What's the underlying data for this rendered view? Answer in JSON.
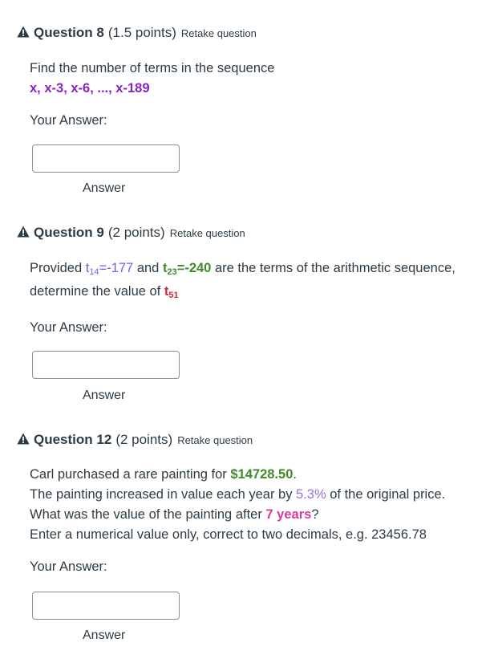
{
  "questions": [
    {
      "title": "Question 8",
      "points": "(1.5 points)",
      "retake": "Retake question",
      "prompt": "Find the number of terms in the sequence",
      "sequence": "x, x-3, x-6, ..., x-189",
      "your_answer_label": "Your Answer:",
      "answer_value": "",
      "answer_label": "Answer"
    },
    {
      "title": "Question 9",
      "points": "(2 points)",
      "retake": "Retake question",
      "line1_start": "Provided ",
      "t14_letter": "t",
      "t14_sub": "14",
      "t14_value": "=-177",
      "and": " and ",
      "t23_letter": "t",
      "t23_sub": "23",
      "t23_value": "=-240",
      "line1_end": " are the terms of the arithmetic sequence,",
      "line2_start": "determine the value of ",
      "t51_letter": "t",
      "t51_sub": "51",
      "your_answer_label": "Your Answer:",
      "answer_value": "",
      "answer_label": "Answer"
    },
    {
      "title": "Question 12",
      "points": "(2 points)",
      "retake": "Retake question",
      "line1_start": "Carl purchased a rare painting for ",
      "price": "$14728.50",
      "line1_end": ".",
      "line2_start": "The painting increased in value each year by ",
      "rate": "5.3%",
      "line2_end": " of the original price.",
      "line3_start": "What was the value of the painting after ",
      "years": "7 years",
      "line3_end": "?",
      "line4": "Enter a numerical value only, correct to two decimals, e.g. 23456.78",
      "your_answer_label": "Your Answer:",
      "answer_value": "",
      "answer_label": "Answer"
    }
  ],
  "colors": {
    "warning_icon": "#2d3b45",
    "sequence_purple": "#8b22c9",
    "t14_blue": "#6f63e0",
    "t23_green": "#3e8a2a",
    "t51_red": "#d2293c",
    "price_green": "#3e8a2a",
    "rate_lavender": "#9a6fe0",
    "years_pink": "#d43aa0"
  },
  "icons": {
    "warning": "warning-triangle-icon"
  }
}
